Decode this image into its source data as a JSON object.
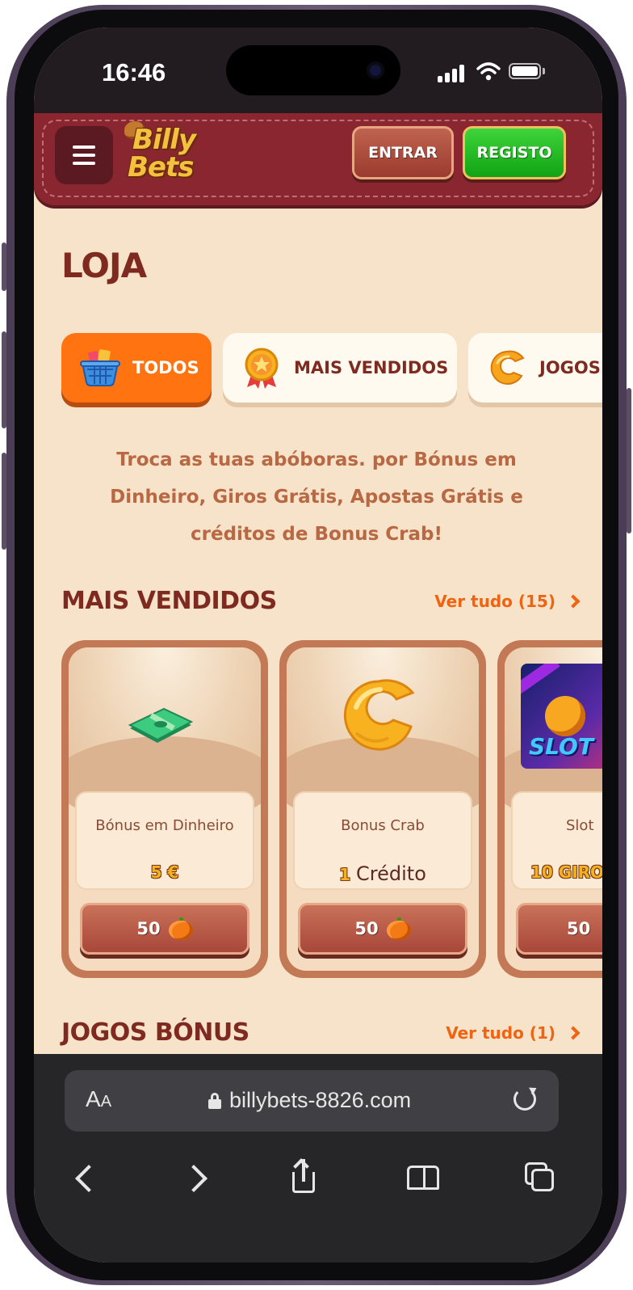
{
  "status_bar": {
    "time": "16:46"
  },
  "header": {
    "logo_line1": "Billy",
    "logo_line2": "Bets",
    "login_label": "ENTRAR",
    "register_label": "REGISTO"
  },
  "page": {
    "title": "LOJA"
  },
  "tabs": [
    {
      "label": "TODOS",
      "icon": "basket-icon",
      "active": true
    },
    {
      "label": "MAIS VENDIDOS",
      "icon": "medal-icon",
      "active": false
    },
    {
      "label": "JOGOS",
      "icon": "crab-coin-icon",
      "active": false
    }
  ],
  "tagline": "Troca as tuas abóboras. por Bónus em Dinheiro, Giros Grátis, Apostas Grátis e créditos de Bonus Crab!",
  "sections": {
    "best_sellers": {
      "title": "MAIS VENDIDOS",
      "see_all": "Ver tudo (15)",
      "cards": [
        {
          "name": "Bónus em Dinheiro",
          "value": "5 €",
          "value_unit": "",
          "price": "50",
          "icon": "cash-stack-icon"
        },
        {
          "name": "Bonus Crab",
          "value": "1",
          "value_unit": "Crédito",
          "price": "50",
          "icon": "crab-coin-icon"
        },
        {
          "name": "Slot",
          "value": "10 GIRO",
          "value_unit": "",
          "price": "50",
          "icon": "slot-game-thumbnail"
        }
      ]
    },
    "bonus_games": {
      "title": "JOGOS BÓNUS",
      "see_all": "Ver tudo (1)"
    }
  },
  "browser": {
    "text_size_label": "A",
    "text_size_label_small": "A",
    "url": "billybets-8826.com"
  },
  "colors": {
    "header": "#8a2630",
    "accent_orange": "#ff7410",
    "register_green": "#11a314",
    "background": "#f7e3c9",
    "title_brown": "#7f2a20"
  }
}
